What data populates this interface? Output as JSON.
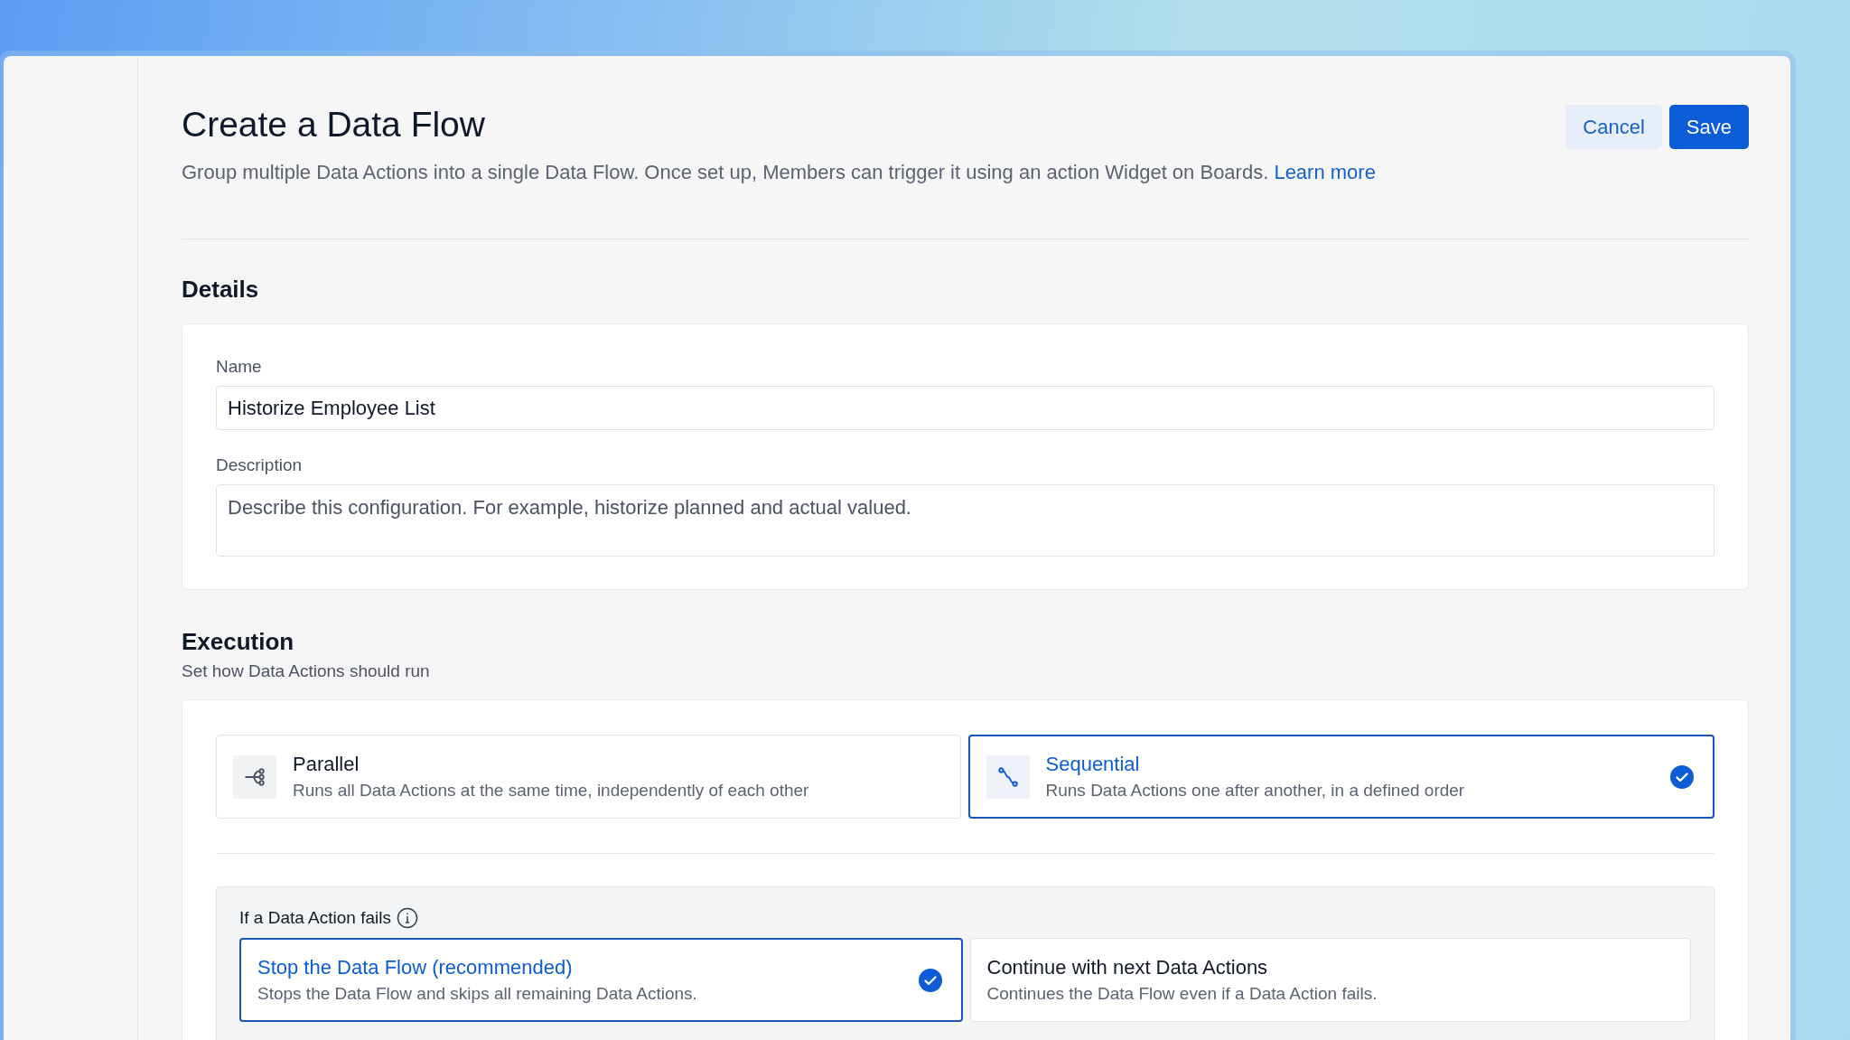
{
  "header": {
    "title": "Create a Data Flow",
    "description": "Group multiple Data Actions into a single Data Flow. Once set up, Members can trigger it using an action Widget on Boards.",
    "link": "Learn more",
    "buttons": [
      {
        "label": "Cancel",
        "kind": "secondary"
      },
      {
        "label": "Save",
        "kind": "primary"
      }
    ]
  },
  "details": {
    "heading": "Details",
    "fields": [
      {
        "label": "Name",
        "value": "Historize Employee List",
        "kind": "input"
      },
      {
        "label": "Description",
        "placeholder": "Describe this configuration. For example, historize planned and actual valued.",
        "kind": "textarea"
      }
    ]
  },
  "execution": {
    "heading": "Execution",
    "subtitle": "Set how Data Actions should run",
    "modes": [
      {
        "title": "Parallel",
        "description": "Runs all Data Actions at the same time, independently of each other",
        "kind": "parallel",
        "selected": false
      },
      {
        "title": "Sequential",
        "description": "Runs Data Actions one after another, in a defined order",
        "kind": "sequential",
        "selected": true
      }
    ],
    "on_failure": {
      "label": "If a Data Action fails",
      "options": [
        {
          "title": "Stop the Data Flow (recommended)",
          "description": "Stops the Data Flow and skips all remaining Data Actions.",
          "selected": true
        },
        {
          "title": "Continue with next Data Actions",
          "description": "Continues the Data Flow even if a Data Action fails.",
          "selected": false
        }
      ]
    }
  }
}
